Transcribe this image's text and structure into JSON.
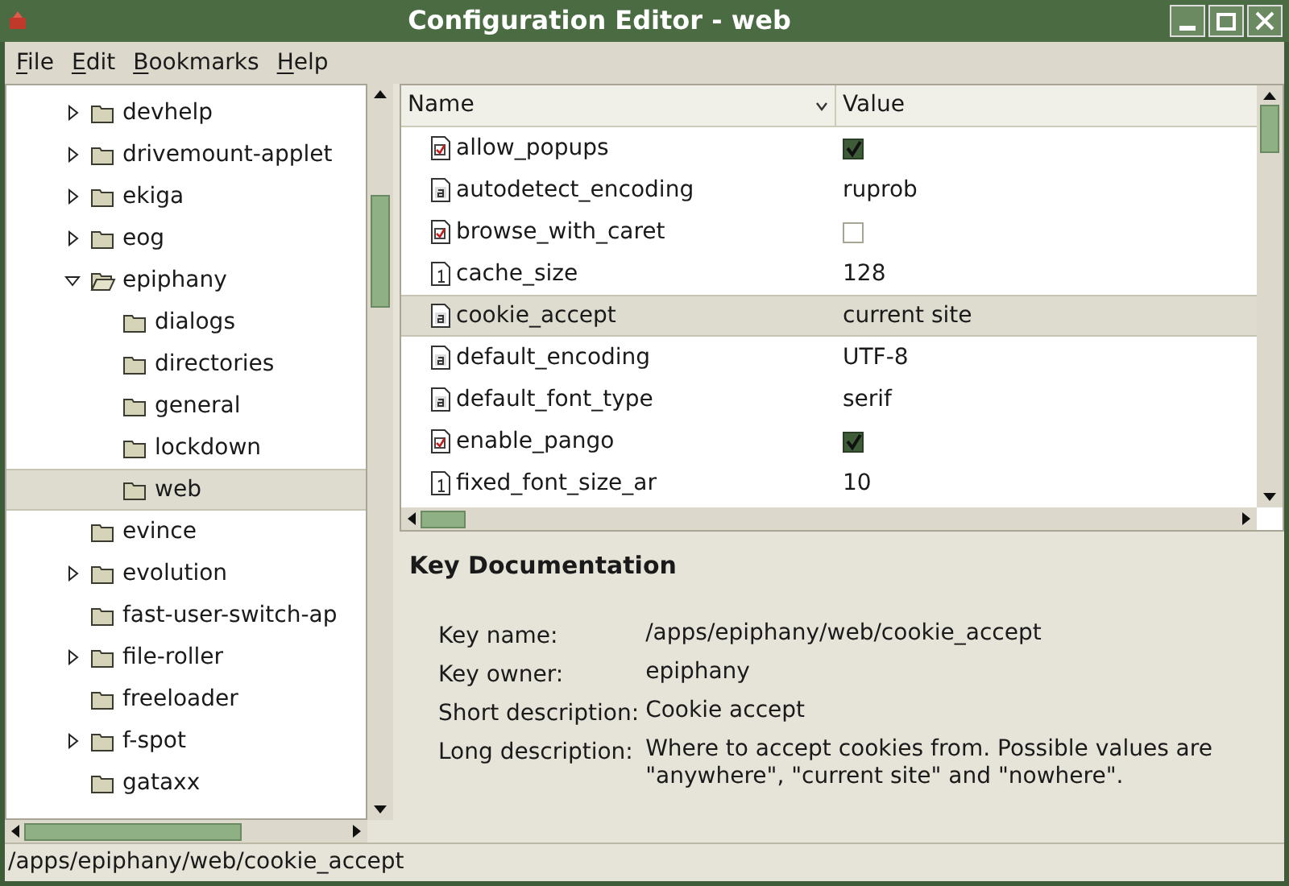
{
  "window": {
    "title": "Configuration Editor - web"
  },
  "menu": [
    "File",
    "Edit",
    "Bookmarks",
    "Help"
  ],
  "tree": [
    {
      "label": "devhelp",
      "kind": "branch",
      "expanded": false,
      "selected": false
    },
    {
      "label": "drivemount-applet",
      "kind": "branch",
      "expanded": false,
      "selected": false
    },
    {
      "label": "ekiga",
      "kind": "branch",
      "expanded": false,
      "selected": false
    },
    {
      "label": "eog",
      "kind": "branch",
      "expanded": false,
      "selected": false
    },
    {
      "label": "epiphany",
      "kind": "branch",
      "expanded": true,
      "selected": false,
      "children": [
        {
          "label": "dialogs",
          "expanded": false,
          "selected": false
        },
        {
          "label": "directories",
          "expanded": false,
          "selected": false
        },
        {
          "label": "general",
          "expanded": false,
          "selected": false
        },
        {
          "label": "lockdown",
          "expanded": false,
          "selected": false
        },
        {
          "label": "web",
          "expanded": false,
          "selected": true
        }
      ]
    },
    {
      "label": "evince",
      "kind": "leaf",
      "expanded": false,
      "selected": false
    },
    {
      "label": "evolution",
      "kind": "branch",
      "expanded": false,
      "selected": false
    },
    {
      "label": "fast-user-switch-ap",
      "kind": "leaf",
      "expanded": false,
      "selected": false
    },
    {
      "label": "file-roller",
      "kind": "branch",
      "expanded": false,
      "selected": false
    },
    {
      "label": "freeloader",
      "kind": "leaf",
      "expanded": false,
      "selected": false
    },
    {
      "label": "f-spot",
      "kind": "branch",
      "expanded": false,
      "selected": false
    },
    {
      "label": "gataxx",
      "kind": "leaf",
      "expanded": false,
      "selected": false
    }
  ],
  "table": {
    "columns": [
      "Name",
      "Value"
    ],
    "rows": [
      {
        "name": "allow_popups",
        "kind": "bool",
        "checked": true,
        "selected": false
      },
      {
        "name": "autodetect_encoding",
        "kind": "string",
        "value": "ruprob",
        "selected": false
      },
      {
        "name": "browse_with_caret",
        "kind": "bool",
        "checked": false,
        "selected": false
      },
      {
        "name": "cache_size",
        "kind": "int",
        "value": "128",
        "selected": false
      },
      {
        "name": "cookie_accept",
        "kind": "string",
        "value": "current site",
        "selected": true
      },
      {
        "name": "default_encoding",
        "kind": "string",
        "value": "UTF-8",
        "selected": false
      },
      {
        "name": "default_font_type",
        "kind": "string",
        "value": "serif",
        "selected": false
      },
      {
        "name": "enable_pango",
        "kind": "bool",
        "checked": true,
        "selected": false
      },
      {
        "name": "fixed_font_size_ar",
        "kind": "int",
        "value": "10",
        "selected": false
      }
    ]
  },
  "documentation": {
    "title": "Key Documentation",
    "fields": [
      {
        "label": "Key name:",
        "value": "/apps/epiphany/web/cookie_accept"
      },
      {
        "label": "Key owner:",
        "value": "epiphany"
      },
      {
        "label": "Short description:",
        "value": "Cookie accept"
      },
      {
        "label": "Long description:",
        "value": "Where to accept cookies from. Possible values are \"anywhere\", \"current site\" and \"nowhere\"."
      }
    ]
  },
  "status_bar": "/apps/epiphany/web/cookie_accept"
}
